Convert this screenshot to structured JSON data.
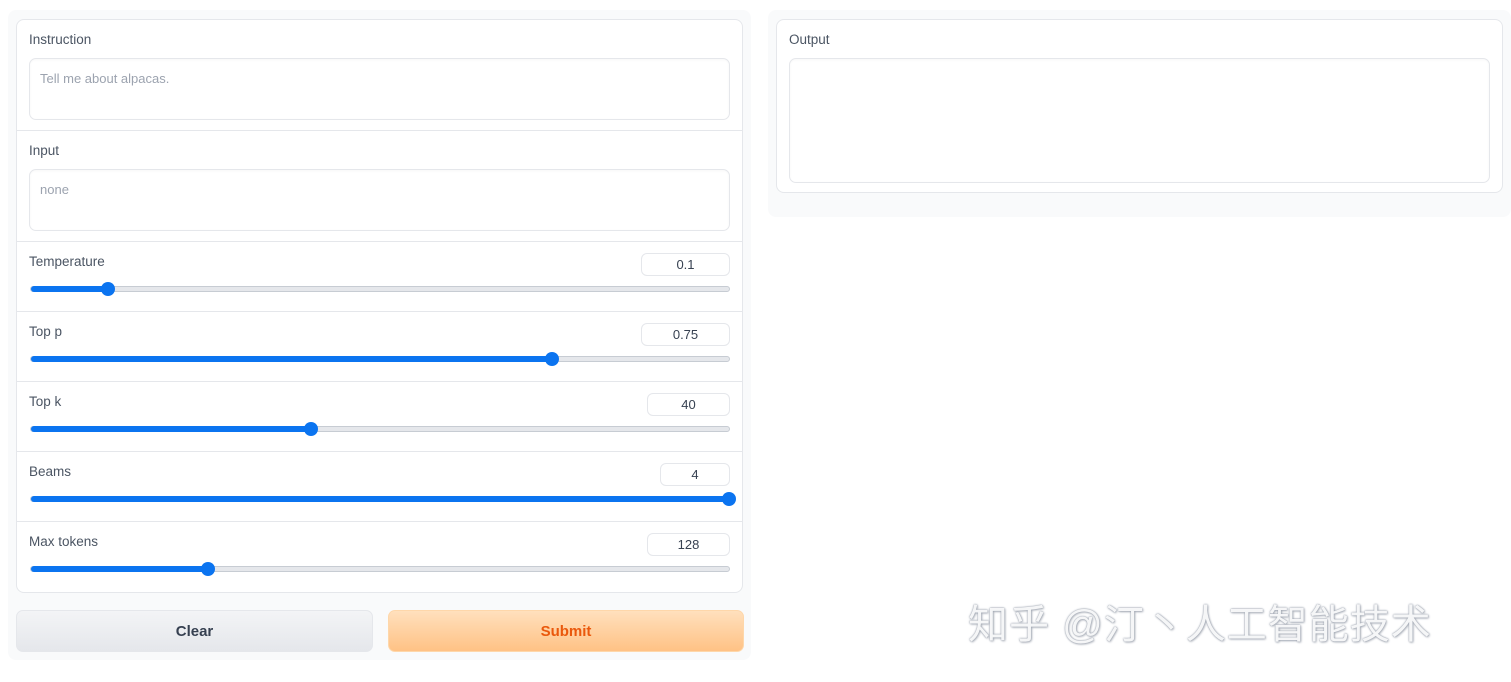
{
  "form": {
    "instruction": {
      "label": "Instruction",
      "placeholder": "Tell me about alpacas."
    },
    "input": {
      "label": "Input",
      "placeholder": "none"
    },
    "sliders": [
      {
        "label": "Temperature",
        "value": "0.1",
        "fraction": 0.11
      },
      {
        "label": "Top p",
        "value": "0.75",
        "fraction": 0.746
      },
      {
        "label": "Top k",
        "value": "40",
        "fraction": 0.401
      },
      {
        "label": "Beams",
        "value": "4",
        "fraction": 1.0
      },
      {
        "label": "Max tokens",
        "value": "128",
        "fraction": 0.253
      }
    ]
  },
  "output": {
    "label": "Output",
    "value": ""
  },
  "buttons": {
    "clear": "Clear",
    "submit": "Submit"
  },
  "watermark": "知乎 @汀丶人工智能技术",
  "colors": {
    "accent": "#0b74f0",
    "submit_text": "#ea580c",
    "submit_bg": "#ffc285"
  }
}
